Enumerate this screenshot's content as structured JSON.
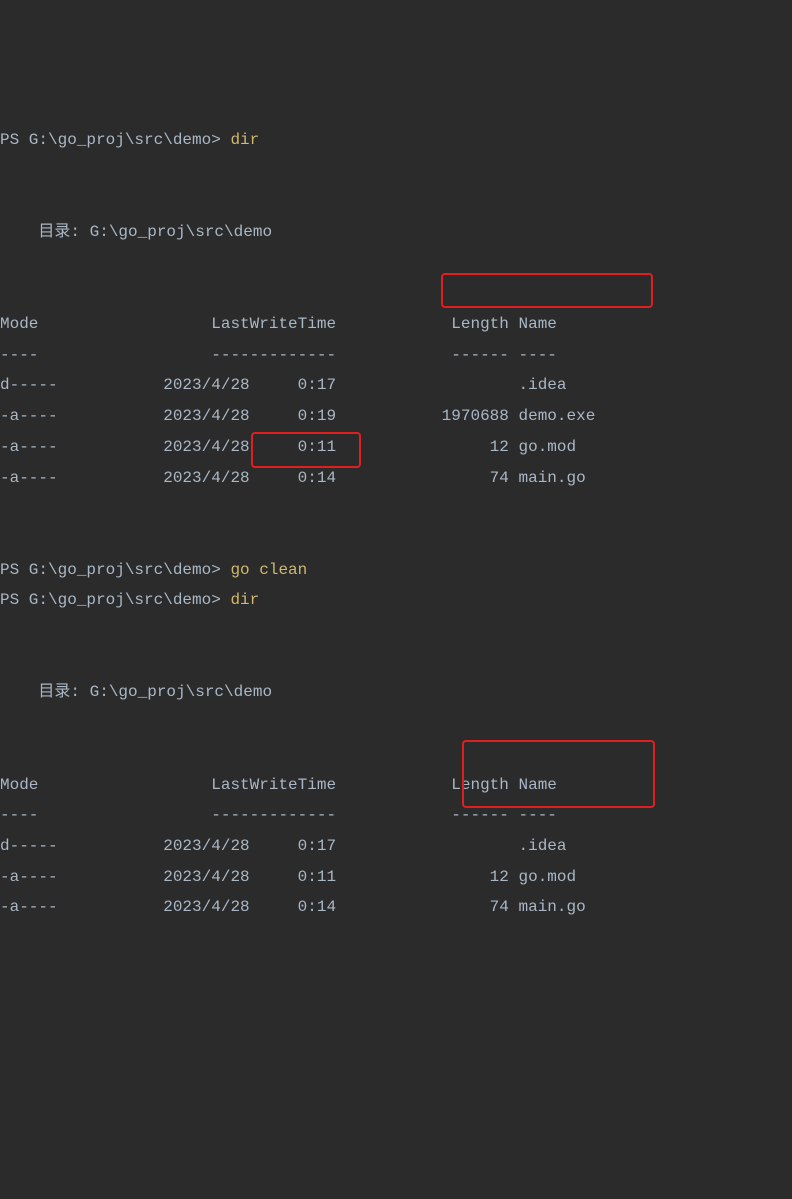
{
  "prompt1": "PS G:\\go_proj\\src\\demo> ",
  "cmd1": "dir",
  "dir_label": "目录: G:\\go_proj\\src\\demo",
  "header": {
    "mode": "Mode",
    "lwt": "LastWriteTime",
    "len": "Length",
    "name": "Name"
  },
  "sep": {
    "mode": "----",
    "lwt": "-------------",
    "len": "------",
    "name": "----"
  },
  "list1": [
    {
      "mode": "d-----",
      "date": "2023/4/28",
      "time": "0:17",
      "len": "",
      "name": ".idea"
    },
    {
      "mode": "-a----",
      "date": "2023/4/28",
      "time": "0:19",
      "len": "1970688",
      "name": "demo.exe"
    },
    {
      "mode": "-a----",
      "date": "2023/4/28",
      "time": "0:11",
      "len": "12",
      "name": "go.mod"
    },
    {
      "mode": "-a----",
      "date": "2023/4/28",
      "time": "0:14",
      "len": "74",
      "name": "main.go"
    }
  ],
  "prompt2": "PS G:\\go_proj\\src\\demo> ",
  "cmd2": "go clean",
  "prompt3": "PS G:\\go_proj\\src\\demo> ",
  "cmd3": "dir",
  "list2": [
    {
      "mode": "d-----",
      "date": "2023/4/28",
      "time": "0:17",
      "len": "",
      "name": ".idea"
    },
    {
      "mode": "-a----",
      "date": "2023/4/28",
      "time": "0:11",
      "len": "12",
      "name": "go.mod"
    },
    {
      "mode": "-a----",
      "date": "2023/4/28",
      "time": "0:14",
      "len": "74",
      "name": "main.go"
    }
  ]
}
